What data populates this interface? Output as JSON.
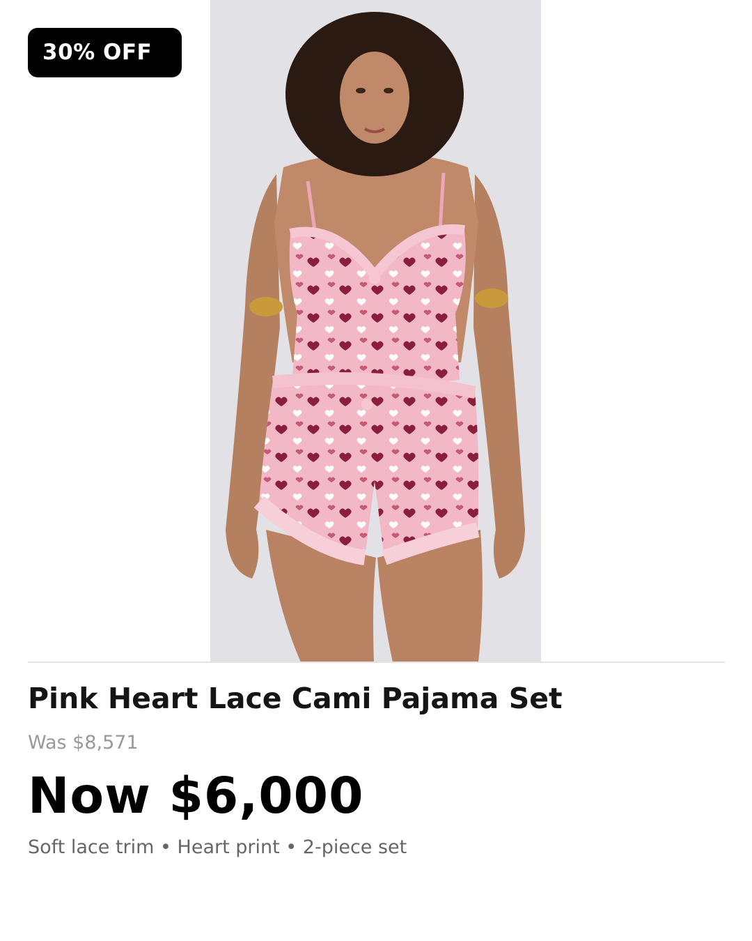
{
  "badge": {
    "label": "30% OFF"
  },
  "product": {
    "title": "Pink Heart Lace Cami Pajama Set",
    "was_price": "Was $8,571",
    "now_price": "Now $6,000",
    "features": "Soft lace trim • Heart print • 2-piece set"
  },
  "colors": {
    "badge_bg": "#000000",
    "garment_pink": "#f2b8c6",
    "heart_dark": "#8a1f3d",
    "photo_bg": "#e2e2e6"
  }
}
